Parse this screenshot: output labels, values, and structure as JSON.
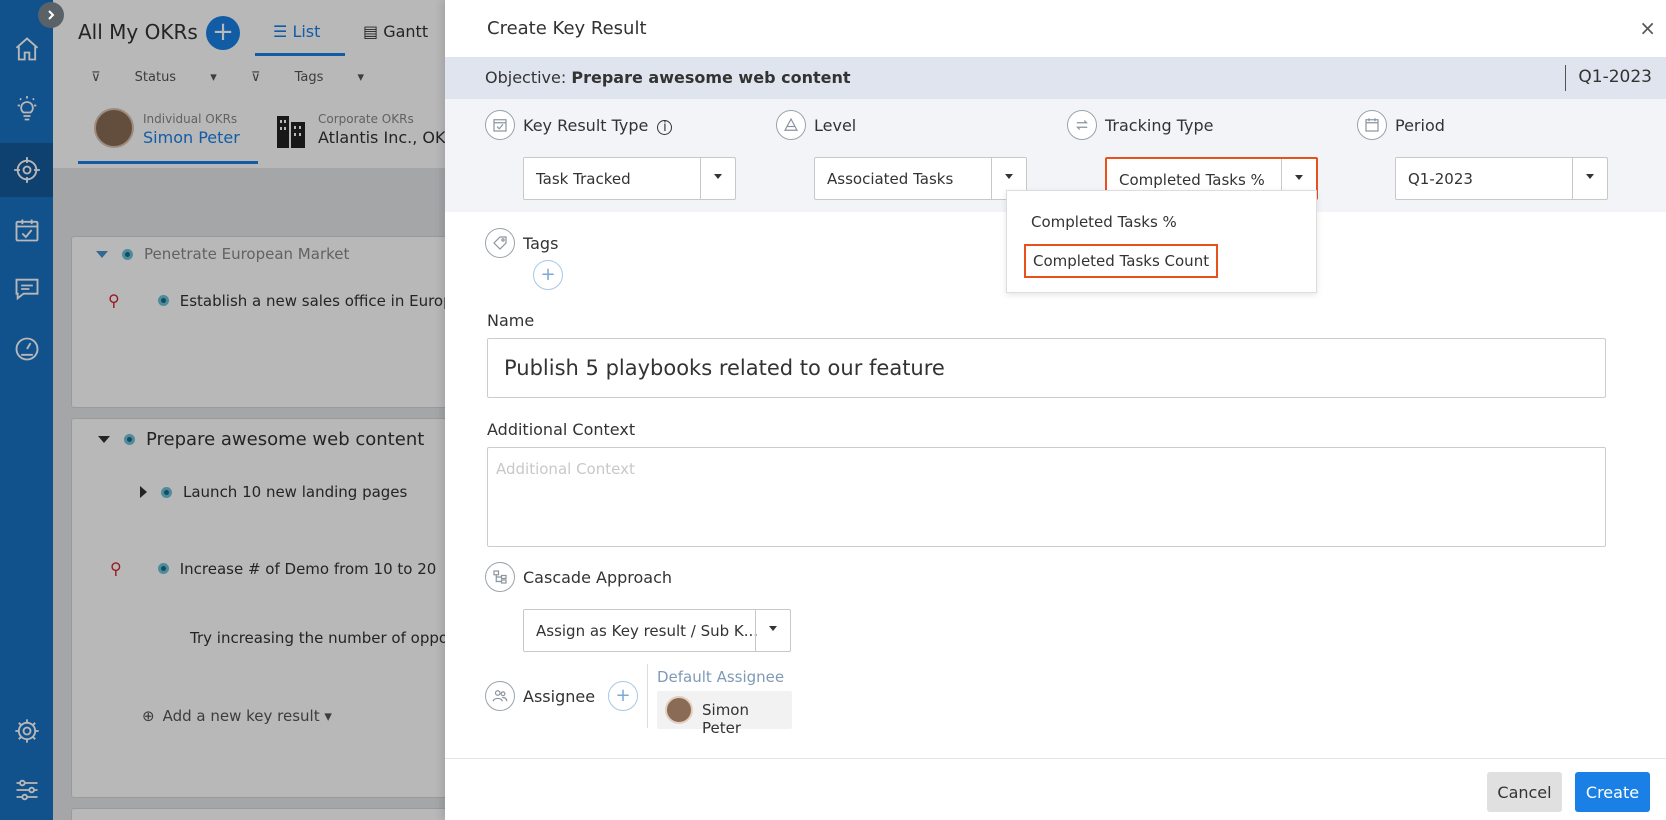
{
  "sidebar": {
    "items": [
      {
        "name": "home",
        "icon": "home-icon"
      },
      {
        "name": "ideas",
        "icon": "lightbulb-icon"
      },
      {
        "name": "okrs",
        "icon": "target-icon",
        "active": true
      },
      {
        "name": "tasks",
        "icon": "calendar-check-icon"
      },
      {
        "name": "chat",
        "icon": "chat-icon"
      },
      {
        "name": "dashboard",
        "icon": "gauge-icon"
      },
      {
        "name": "settings",
        "icon": "gear-icon"
      },
      {
        "name": "preferences",
        "icon": "sliders-icon"
      }
    ],
    "accent": "#1a72c3"
  },
  "app": {
    "title": "All My OKRs",
    "tabs": {
      "list": "List",
      "gantt": "Gantt"
    },
    "filters": {
      "status": "Status",
      "tags": "Tags"
    },
    "okr_tabs": [
      {
        "small": "Individual OKRs",
        "big": "Simon Peter"
      },
      {
        "small": "Corporate OKRs",
        "big": "Atlantis Inc., OKR"
      }
    ],
    "objectives": [
      {
        "title": "Penetrate European Market",
        "key_results": [
          "Establish a new sales office in Europ"
        ]
      },
      {
        "title": "Prepare awesome web content",
        "key_results": [
          "Launch 10 new landing pages",
          "Increase # of Demo from 10 to 20"
        ],
        "note": "Try increasing the number of oppor",
        "add_link": "Add a new key result"
      }
    ]
  },
  "modal": {
    "title": "Create Key Result",
    "close_label": "×",
    "objective_prefix": "Objective:",
    "objective_name": "Prepare awesome web content",
    "objective_period": "Q1-2023",
    "fields": {
      "key_result_type": {
        "label": "Key Result Type",
        "value": "Task Tracked"
      },
      "level": {
        "label": "Level",
        "value": "Associated Tasks"
      },
      "tracking_type": {
        "label": "Tracking Type",
        "value": "Completed Tasks %"
      },
      "period": {
        "label": "Period",
        "value": "Q1-2023"
      }
    },
    "tracking_dropdown": {
      "options": [
        "Completed Tasks %",
        "Completed Tasks Count"
      ],
      "highlighted": "Completed Tasks Count"
    },
    "tags_label": "Tags",
    "name_label": "Name",
    "name_value": "Publish 5 playbooks related to our feature",
    "context_label": "Additional Context",
    "context_placeholder": "Additional Context",
    "cascade": {
      "label": "Cascade Approach",
      "value": "Assign as Key result / Sub K..."
    },
    "assignee": {
      "label": "Assignee",
      "default_label": "Default Assignee",
      "name": "Simon Peter"
    },
    "buttons": {
      "cancel": "Cancel",
      "create": "Create"
    },
    "highlight_color": "#e8501c",
    "primary_color": "#1a80e5"
  }
}
